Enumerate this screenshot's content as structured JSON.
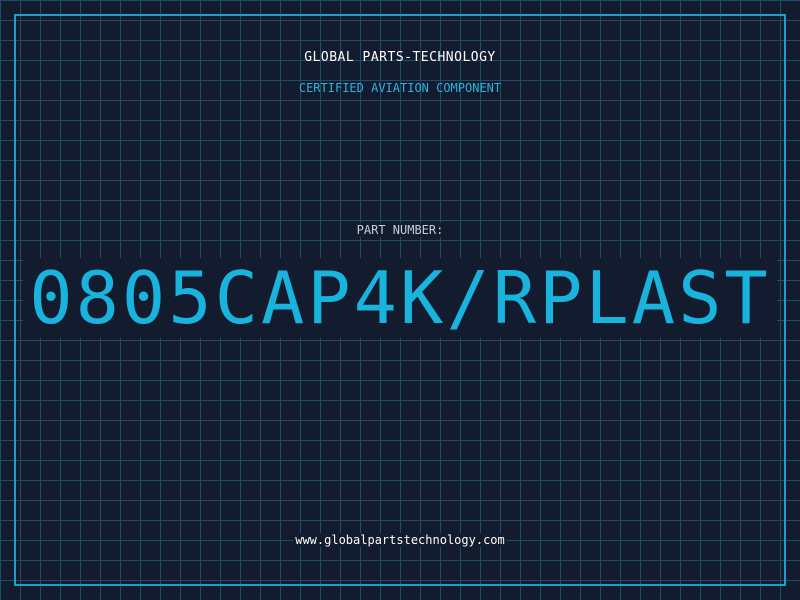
{
  "header": {
    "company_name": "GLOBAL PARTS-TECHNOLOGY",
    "tagline": "CERTIFIED AVIATION COMPONENT"
  },
  "part": {
    "label": "PART NUMBER:",
    "number": "0805CAP4K/RPLAST"
  },
  "footer": {
    "website": "www.globalpartstechnology.com"
  },
  "colors": {
    "background": "#131b2e",
    "grid": "#1f4d68",
    "frame": "#1f9fcf",
    "accent": "#18b4de",
    "title_text": "#ffffff"
  }
}
